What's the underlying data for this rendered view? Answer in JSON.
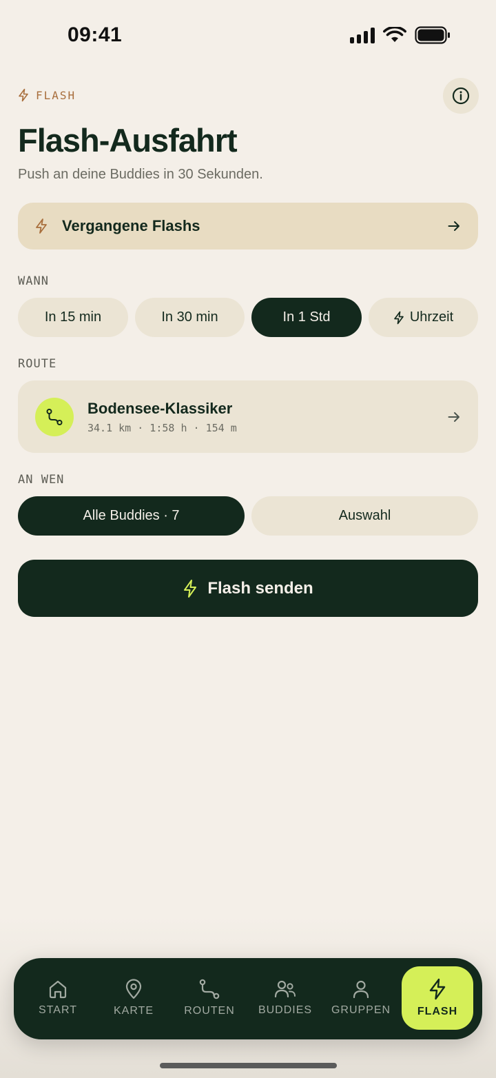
{
  "status": {
    "time": "09:41"
  },
  "header": {
    "eyebrow": "FLASH",
    "title": "Flash-Ausfahrt",
    "subtitle": "Push an deine Buddies in 30 Sekunden."
  },
  "past_flashes": {
    "label": "Vergangene Flashs"
  },
  "when": {
    "label": "WANN",
    "options": [
      {
        "label": "In 15 min",
        "selected": false
      },
      {
        "label": "In 30 min",
        "selected": false
      },
      {
        "label": "In 1 Std",
        "selected": true
      },
      {
        "label": "Uhrzeit",
        "selected": false
      }
    ]
  },
  "route": {
    "label": "ROUTE",
    "name": "Bodensee-Klassiker",
    "meta": "34.1 km · 1:58 h · 154 m"
  },
  "recipients": {
    "label": "AN WEN",
    "options": [
      {
        "label": "Alle Buddies · 7",
        "selected": true
      },
      {
        "label": "Auswahl",
        "selected": false
      }
    ]
  },
  "send_button": {
    "label": "Flash senden"
  },
  "tabs": [
    {
      "label": "START",
      "icon": "home-icon"
    },
    {
      "label": "KARTE",
      "icon": "map-pin-icon"
    },
    {
      "label": "ROUTEN",
      "icon": "route-icon"
    },
    {
      "label": "BUDDIES",
      "icon": "buddies-icon"
    },
    {
      "label": "GRUPPEN",
      "icon": "person-icon"
    },
    {
      "label": "FLASH",
      "icon": "bolt-icon",
      "active": true
    }
  ],
  "colors": {
    "background": "#f4efe8",
    "dark_green": "#13291d",
    "lime": "#d5ef58",
    "sand": "#e8dcc2",
    "accent_brown": "#a86e3c"
  }
}
